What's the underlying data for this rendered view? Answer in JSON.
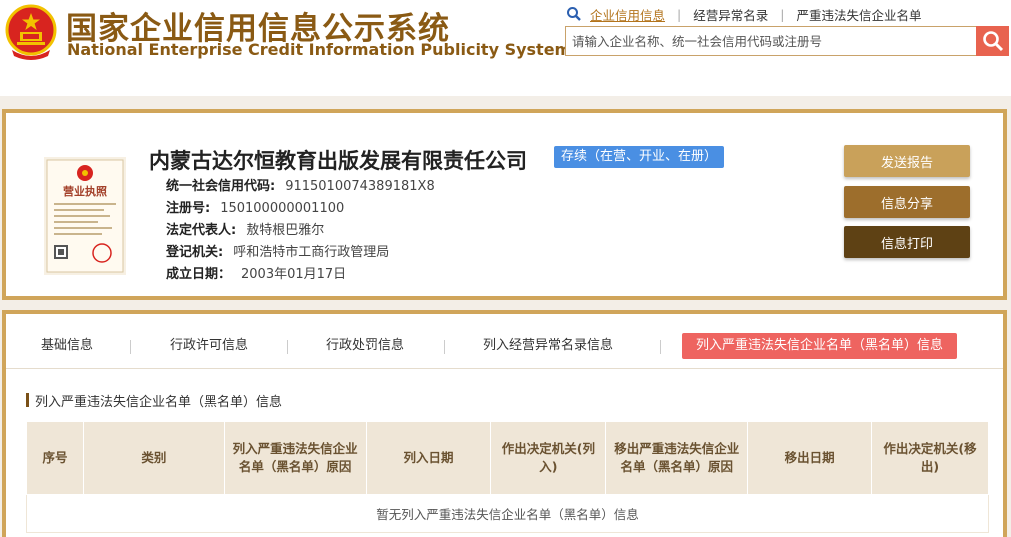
{
  "header": {
    "title": "国家企业信用信息公示系统",
    "subtitle": "National Enterprise Credit Information Publicity System",
    "links": [
      "企业信用信息",
      "经营异常名录",
      "严重违法失信企业名单"
    ],
    "search_placeholder": "请输入企业名称、统一社会信用代码或注册号"
  },
  "company": {
    "name": "内蒙古达尔恒教育出版发展有限责任公司",
    "status": "存续（在营、开业、在册）",
    "fields": [
      {
        "label": "统一社会信用代码:",
        "value": "9115010074389181X8"
      },
      {
        "label": "注册号:",
        "value": "150100000001100"
      },
      {
        "label": "法定代表人:",
        "value": "敖特根巴雅尔"
      },
      {
        "label": "登记机关:",
        "value": "呼和浩特市工商行政管理局"
      },
      {
        "label": "成立日期：",
        "value": "2003年01月17日"
      }
    ],
    "license_label": "营业执照",
    "buttons": {
      "report": "发送报告",
      "share": "信息分享",
      "print": "信息打印"
    }
  },
  "tabs": [
    {
      "label": "基础信息"
    },
    {
      "label": "行政许可信息"
    },
    {
      "label": "行政处罚信息"
    },
    {
      "label": "列入经营异常名录信息"
    },
    {
      "label": "列入严重违法失信企业名单（黑名单）信息"
    }
  ],
  "section": {
    "title": "列入严重违法失信企业名单（黑名单）信息",
    "columns": [
      "序号",
      "类别",
      "列入严重违法失信企业名单（黑名单）原因",
      "列入日期",
      "作出决定机关(列入)",
      "移出严重违法失信企业名单（黑名单）原因",
      "移出日期",
      "作出决定机关(移出)"
    ],
    "empty_message": "暂无列入严重违法失信企业名单（黑名单）信息"
  },
  "colors": {
    "brand": "#8a5a14",
    "accent": "#ee6460",
    "border": "#d0a55a",
    "badge": "#4a8fe3"
  }
}
